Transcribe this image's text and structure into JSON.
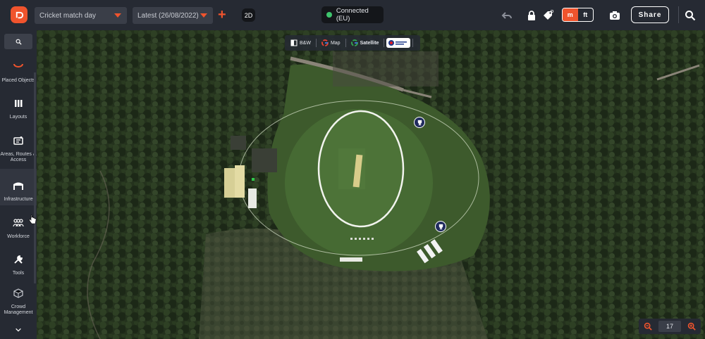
{
  "topbar": {
    "project_select": "Cricket match day",
    "version_select": "Latest (26/08/2022)",
    "view_mode": "2D",
    "connection_status": "Connected (EU)",
    "units": [
      "m",
      "ft"
    ],
    "active_unit": "m",
    "share_label": "Share",
    "icons": [
      "undo-icon",
      "lock-icon",
      "tag-visibility-icon",
      "camera-icon",
      "search-icon"
    ]
  },
  "sidebar": {
    "items": [
      {
        "label": "Placed Objects",
        "icon": "placed-objects-icon"
      },
      {
        "label": "Layouts",
        "icon": "layouts-icon"
      },
      {
        "label": "Areas, Routes & Access",
        "icon": "areas-routes-icon"
      },
      {
        "label": "Infrastructure",
        "icon": "infrastructure-icon"
      },
      {
        "label": "Workforce",
        "icon": "workforce-icon"
      },
      {
        "label": "Tools",
        "icon": "tools-icon"
      },
      {
        "label": "Crowd Management",
        "icon": "crowd-management-icon"
      }
    ],
    "active_item": "Infrastructure"
  },
  "map": {
    "layers": [
      "B&W",
      "Map",
      "Satellite"
    ],
    "active_layer": "Satellite",
    "ordnance_badge": "Ordnance Survey",
    "zoom_level": "17"
  },
  "colors": {
    "accent": "#f0542d",
    "topbar": "#262a33",
    "connected": "#3ec46d",
    "pin": "#202b5e"
  }
}
